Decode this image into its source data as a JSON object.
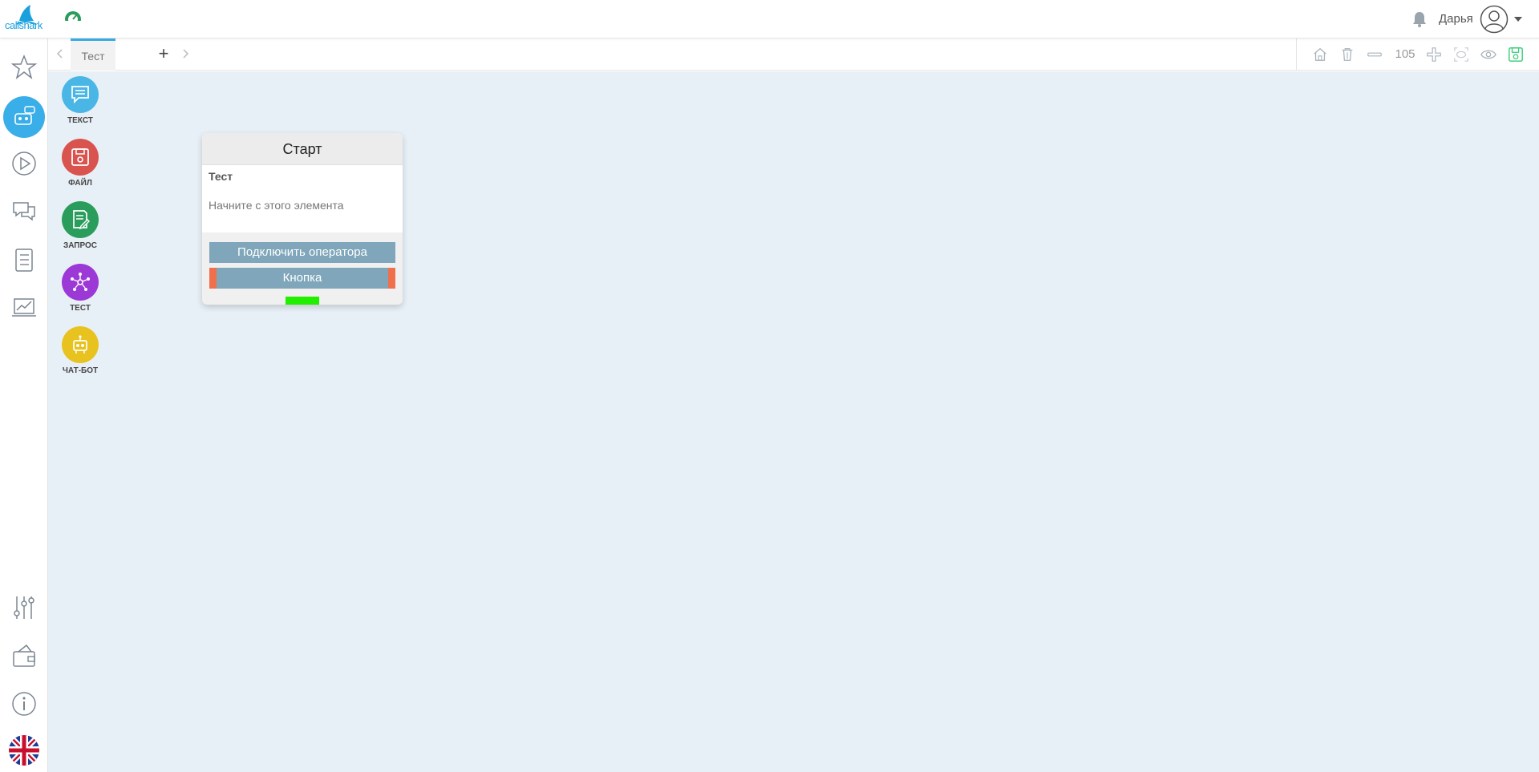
{
  "header": {
    "logo_text": "callshark",
    "user_name": "Дарья"
  },
  "tabs": [
    {
      "label": "Тест",
      "active": true
    }
  ],
  "tab_add_label": "+",
  "toolbar": {
    "zoom": "105"
  },
  "palette": [
    {
      "label": "ТЕКСТ",
      "color": "#4ab6e6",
      "icon": "message-icon"
    },
    {
      "label": "ФАЙЛ",
      "color": "#d9534f",
      "icon": "save-file-icon"
    },
    {
      "label": "ЗАПРОС",
      "color": "#2a9d5c",
      "icon": "request-icon"
    },
    {
      "label": "ТЕСТ",
      "color": "#9b38d6",
      "icon": "network-icon"
    },
    {
      "label": "ЧАТ-БОТ",
      "color": "#e8c21e",
      "icon": "robot-icon"
    }
  ],
  "node": {
    "header": "Старт",
    "title": "Тест",
    "description": "Начните с этого элемента",
    "buttons": [
      "Подключить оператора",
      "Кнопка"
    ]
  },
  "colors": {
    "accent": "#3aaee8",
    "canvas": "#e8f0f7",
    "node_button": "#7fa6ba",
    "button_edge": "#f0704e",
    "connector": "#22ee00"
  }
}
